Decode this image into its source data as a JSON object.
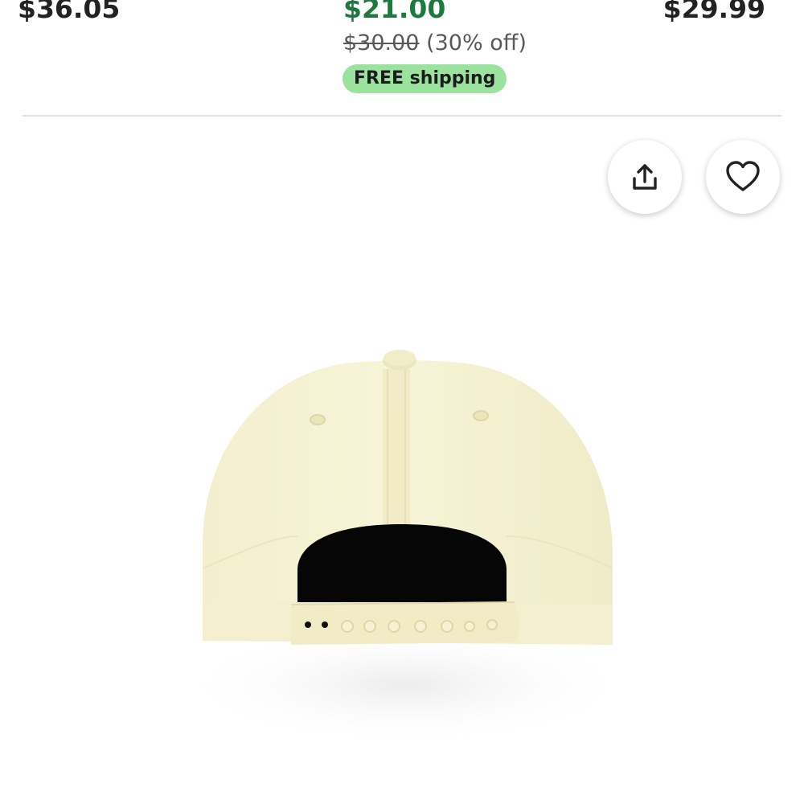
{
  "listing_prices": {
    "left_price": "$36.05",
    "middle": {
      "sale_price": "$21.00",
      "original_price": "$30.00",
      "discount": "(30% off)",
      "shipping_badge": "FREE shipping"
    },
    "right_price": "$29.99"
  },
  "product_image": {
    "actions": {
      "share_icon": "share-icon",
      "favorite_icon": "heart-icon"
    }
  },
  "colors": {
    "sale_price": "#1d7a3e",
    "shipping_badge_bg": "#9be29f",
    "cap_body": "#f7f4d6"
  }
}
